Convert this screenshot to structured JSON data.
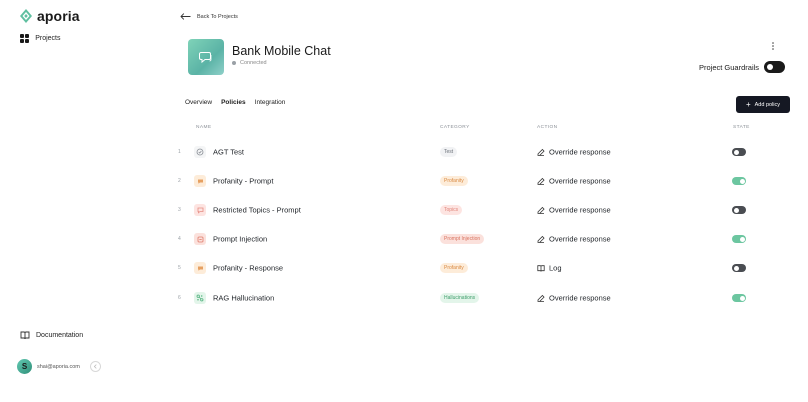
{
  "brand": {
    "name": "aporia"
  },
  "sidebar": {
    "projects_label": "Projects",
    "documentation_label": "Documentation",
    "user_email": "shai@aporia.com",
    "user_initial": "S"
  },
  "header": {
    "back_label": "Back To Projects",
    "project_title": "Bank Mobile Chat",
    "project_status": "Connected",
    "guardrails_label": "Project Guardrails"
  },
  "tabs": [
    {
      "label": "Overview"
    },
    {
      "label": "Policies"
    },
    {
      "label": "Integration"
    }
  ],
  "add_button": {
    "label": "Add policy"
  },
  "table": {
    "headers": {
      "name": "NAME",
      "category": "CATEGORY",
      "action": "ACTION",
      "state": "STATE"
    },
    "rows": [
      {
        "index": "1",
        "name": "AGT Test",
        "category": "Test",
        "action": "Override response",
        "enabled": false,
        "icon": "shield-icon"
      },
      {
        "index": "2",
        "name": "Profanity - Prompt",
        "category": "Profanity",
        "action": "Override response",
        "enabled": true,
        "icon": "profanity-icon"
      },
      {
        "index": "3",
        "name": "Restricted Topics - Prompt",
        "category": "Topics",
        "action": "Override response",
        "enabled": false,
        "icon": "topics-icon"
      },
      {
        "index": "4",
        "name": "Prompt Injection",
        "category": "Prompt Injection",
        "action": "Override response",
        "enabled": true,
        "icon": "injection-icon"
      },
      {
        "index": "5",
        "name": "Profanity - Response",
        "category": "Profanity",
        "action": "Log",
        "enabled": false,
        "icon": "profanity-icon"
      },
      {
        "index": "6",
        "name": "RAG Hallucination",
        "category": "Hallucinations",
        "action": "Override response",
        "enabled": true,
        "icon": "hallucination-icon"
      }
    ]
  },
  "colors": {
    "accent_green": "#6cc6a0",
    "button_dark": "#151823",
    "badge_test_bg": "#f1f2f4",
    "badge_profanity_bg": "#fdecd9",
    "badge_topics_bg": "#fde4e1",
    "badge_injection_bg": "#fbe1dc",
    "badge_hallucination_bg": "#e3f5ea"
  }
}
